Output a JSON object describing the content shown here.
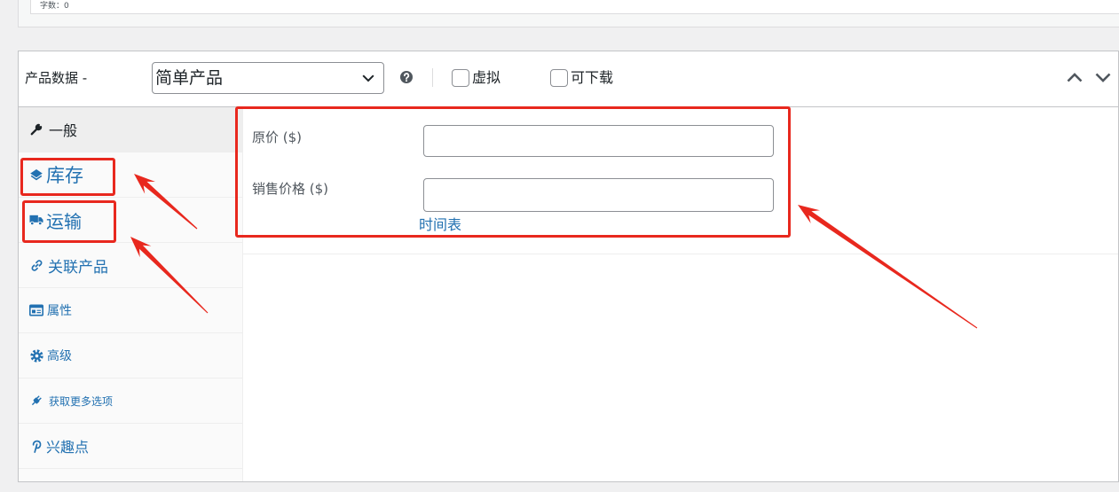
{
  "editor": {
    "word_count": "字数：0"
  },
  "product_data": {
    "title": "产品数据 -",
    "product_type": {
      "selected": "简单产品",
      "icon": "chevron-down-icon"
    },
    "help_icon": "help-icon",
    "virtual": {
      "label": "虚拟",
      "checked": false
    },
    "downloadable": {
      "label": "可下载",
      "checked": false
    },
    "toggle_icons": [
      "chevron-up-icon",
      "chevron-down-icon"
    ]
  },
  "tabs": [
    {
      "label": "一般",
      "icon": "wrench-icon",
      "active": true
    },
    {
      "label": "库存",
      "icon": "inventory-icon",
      "active": false
    },
    {
      "label": "运输",
      "icon": "truck-icon",
      "active": false
    },
    {
      "label": "关联产品",
      "icon": "link-icon",
      "active": false
    },
    {
      "label": "属性",
      "icon": "attributes-icon",
      "active": false
    },
    {
      "label": "高级",
      "icon": "gear-icon",
      "active": false
    },
    {
      "label": "获取更多选项",
      "icon": "plug-icon",
      "active": false
    },
    {
      "label": "兴趣点",
      "icon": "pinterest-icon",
      "active": false
    }
  ],
  "general": {
    "regular_price": {
      "label": "原价 ($)",
      "value": ""
    },
    "sale_price": {
      "label": "销售价格 ($)",
      "value": ""
    },
    "schedule_link": "时间表"
  },
  "colors": {
    "accent": "#2271b1",
    "active_tab_bg": "#eeeeee",
    "annotation_red": "#e8281e"
  }
}
